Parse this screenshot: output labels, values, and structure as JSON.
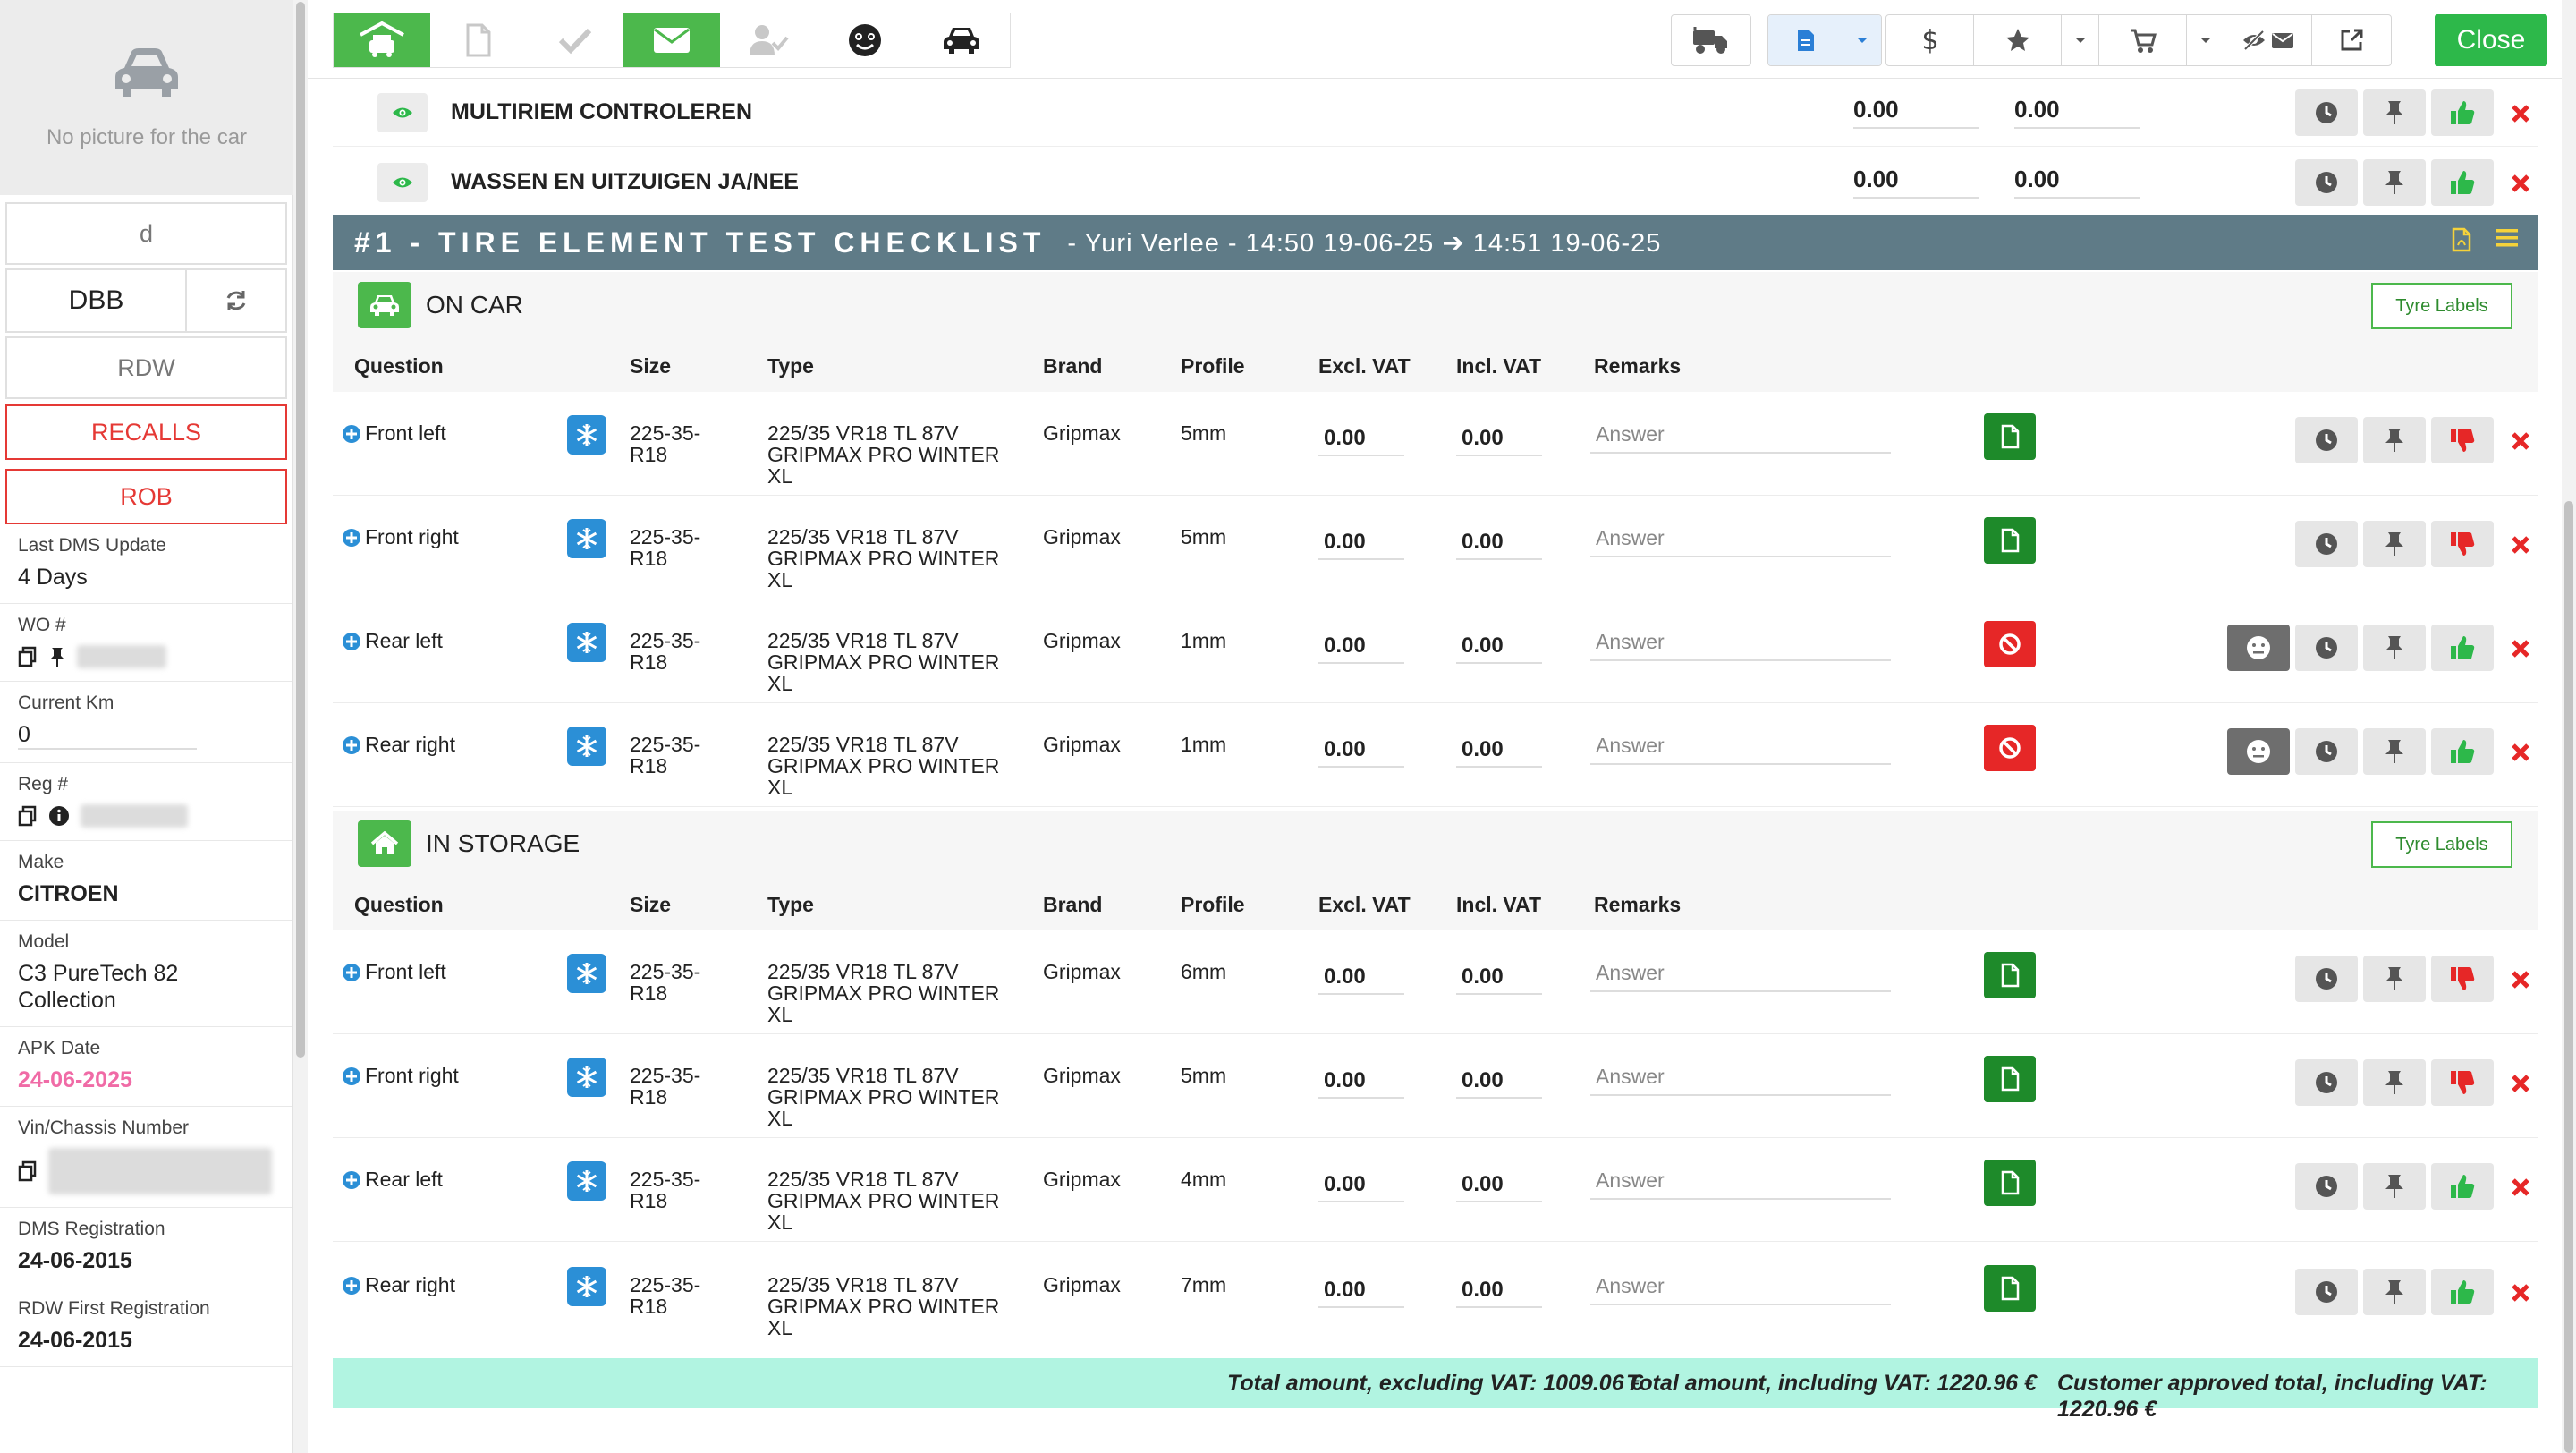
{
  "sidebar": {
    "no_picture": "No picture for the car",
    "field_d": "d",
    "dbb": "DBB",
    "rdw": "RDW",
    "recalls": "RECALLS",
    "rob": "ROB",
    "fields": {
      "last_dms_label": "Last DMS Update",
      "last_dms_value": "4 Days",
      "wo_label": "WO #",
      "km_label": "Current Km",
      "km_value": "0",
      "reg_label": "Reg #",
      "make_label": "Make",
      "make_value": "CITROEN",
      "model_label": "Model",
      "model_value": "C3 PureTech 82 Collection",
      "apk_label": "APK Date",
      "apk_value": "24-06-2025",
      "vin_label": "Vin/Chassis Number",
      "dms_reg_label": "DMS Registration",
      "dms_reg_value": "24-06-2015",
      "rdw_first_label": "RDW First Registration",
      "rdw_first_value": "24-06-2015"
    }
  },
  "toolbar": {
    "close_label": "Close"
  },
  "top_rows": [
    {
      "name": "MULTIRIEM CONTROLEREN",
      "v1": "0.00",
      "v2": "0.00"
    },
    {
      "name": "WASSEN EN UITZUIGEN JA/NEE",
      "v1": "0.00",
      "v2": "0.00"
    }
  ],
  "checklist": {
    "title": "#1 - TIRE ELEMENT TEST CHECKLIST",
    "meta": "-  Yuri Verlee - 14:50 19-06-25 ➔ 14:51 19-06-25"
  },
  "columns": {
    "question": "Question",
    "size": "Size",
    "type": "Type",
    "brand": "Brand",
    "profile": "Profile",
    "excl": "Excl. VAT",
    "incl": "Incl. VAT",
    "remarks": "Remarks"
  },
  "tyre_labels": "Tyre Labels",
  "answer_placeholder": "Answer",
  "on_car": {
    "title": "ON CAR",
    "rows": [
      {
        "q": "Front left",
        "size": "225-35-R18",
        "type": "225/35 VR18 TL 87V GRIPMAX PRO WINTER XL",
        "brand": "Gripmax",
        "profile": "5mm",
        "excl": "0.00",
        "incl": "0.00",
        "remark": "Answer"
      },
      {
        "q": "Front right",
        "size": "225-35-R18",
        "type": "225/35 VR18 TL 87V GRIPMAX PRO WINTER XL",
        "brand": "Gripmax",
        "profile": "5mm",
        "excl": "0.00",
        "incl": "0.00",
        "remark": "Answer"
      },
      {
        "q": "Rear left",
        "size": "225-35-R18",
        "type": "225/35 VR18 TL 87V GRIPMAX PRO WINTER XL",
        "brand": "Gripmax",
        "profile": "1mm",
        "excl": "0.00",
        "incl": "0.00",
        "remark": "Answer"
      },
      {
        "q": "Rear right",
        "size": "225-35-R18",
        "type": "225/35 VR18 TL 87V GRIPMAX PRO WINTER XL",
        "brand": "Gripmax",
        "profile": "1mm",
        "excl": "0.00",
        "incl": "0.00",
        "remark": "Answer"
      }
    ]
  },
  "in_storage": {
    "title": "IN STORAGE",
    "rows": [
      {
        "q": "Front left",
        "size": "225-35-R18",
        "type": "225/35 VR18 TL 87V GRIPMAX PRO WINTER XL",
        "brand": "Gripmax",
        "profile": "6mm",
        "excl": "0.00",
        "incl": "0.00",
        "remark": "Answer"
      },
      {
        "q": "Front right",
        "size": "225-35-R18",
        "type": "225/35 VR18 TL 87V GRIPMAX PRO WINTER XL",
        "brand": "Gripmax",
        "profile": "5mm",
        "excl": "0.00",
        "incl": "0.00",
        "remark": "Answer"
      },
      {
        "q": "Rear left",
        "size": "225-35-R18",
        "type": "225/35 VR18 TL 87V GRIPMAX PRO WINTER XL",
        "brand": "Gripmax",
        "profile": "4mm",
        "excl": "0.00",
        "incl": "0.00",
        "remark": "Answer"
      },
      {
        "q": "Rear right",
        "size": "225-35-R18",
        "type": "225/35 VR18 TL 87V GRIPMAX PRO WINTER XL",
        "brand": "Gripmax",
        "profile": "7mm",
        "excl": "0.00",
        "incl": "0.00",
        "remark": "Answer"
      }
    ]
  },
  "totals": {
    "excl": "Total amount, excluding VAT: 1009.06 €",
    "incl": "Total amount, including VAT: 1220.96 €",
    "approved": "Customer approved total, including VAT: 1220.96 €"
  },
  "colors": {
    "green": "#4cb84c",
    "red": "#e62727",
    "blue": "#2b8fd6",
    "header": "#5f7b87",
    "highlight": "#f0256e",
    "totals_bg": "#b1f4e1"
  }
}
